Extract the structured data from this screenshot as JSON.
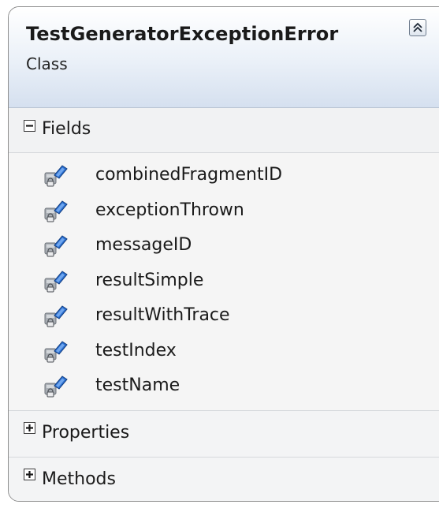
{
  "class": {
    "name": "TestGeneratorExceptionError",
    "kind": "Class"
  },
  "sections": {
    "fields": {
      "label": "Fields",
      "state": "expanded",
      "items": [
        {
          "name": "combinedFragmentID",
          "icon": "private-field-icon"
        },
        {
          "name": "exceptionThrown",
          "icon": "private-field-icon"
        },
        {
          "name": "messageID",
          "icon": "private-field-icon"
        },
        {
          "name": "resultSimple",
          "icon": "private-field-icon"
        },
        {
          "name": "resultWithTrace",
          "icon": "private-field-icon"
        },
        {
          "name": "testIndex",
          "icon": "private-field-icon"
        },
        {
          "name": "testName",
          "icon": "private-field-icon"
        }
      ]
    },
    "properties": {
      "label": "Properties",
      "state": "collapsed"
    },
    "methods": {
      "label": "Methods",
      "state": "collapsed"
    }
  },
  "colors": {
    "border": "#8c8c8c",
    "header_gradient_end": "#d5e0ef",
    "field_icon_blue": "#2a6fd1",
    "field_icon_gray": "#9aa0a6"
  }
}
